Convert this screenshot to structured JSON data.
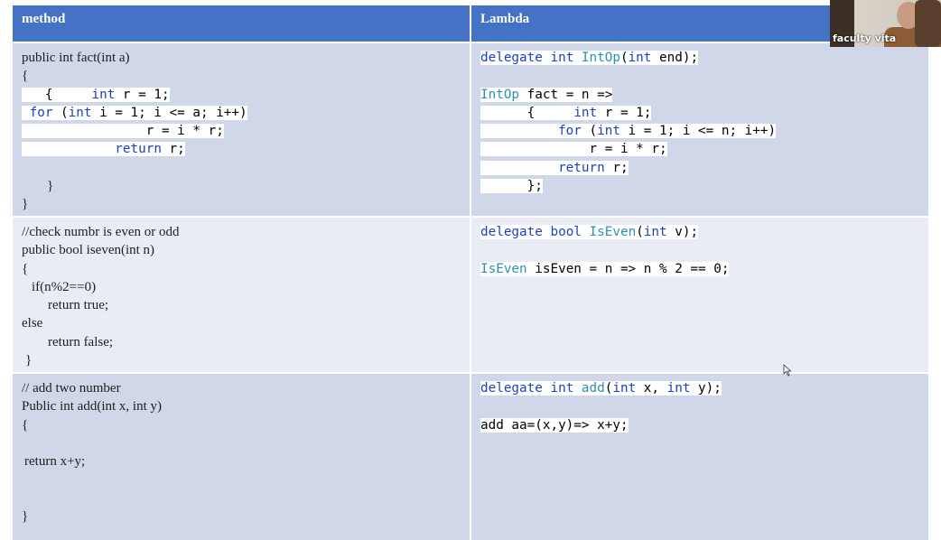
{
  "table": {
    "headers": [
      "method",
      "Lambda"
    ],
    "rows": [
      {
        "method": [
          "public int fact(int a)",
          "{",
          "",
          "",
          "",
          "",
          "",
          "}",
          "}"
        ],
        "lambda": [
          "delegate int IntOp(int end);",
          "",
          "IntOp fact = n =>",
          "{",
          "for",
          "r = i * r;",
          "return r;",
          "};"
        ]
      },
      {
        "method": [
          "//check numbr is even or odd",
          "public bool iseven(int n)",
          "{",
          "if(n%2==0)",
          "return true;",
          "else",
          "return false;",
          "}"
        ],
        "lambda": [
          "delegate bool IsEven(int v);",
          "",
          "IsEven isEven = n => n % 2 == 0;"
        ]
      },
      {
        "method": [
          "// add two number",
          "Public int add(int x, int y)",
          "{",
          "",
          "return x+y;",
          "",
          "",
          "}"
        ],
        "lambda": [
          "delegate int add(int x, int y);",
          "",
          "add aa=(x,y)=> x+y;"
        ]
      }
    ]
  },
  "code": {
    "fact_line3_open": "{",
    "fact_line3_kw": "int",
    "fact_line3_rest": " r = 1;",
    "fact_for_kw": "for",
    "fact_for_paren": " (",
    "fact_for_int": "int",
    "fact_for_rest": " i = 1; i <= a; i++)",
    "fact_assign": "r = i * r;",
    "fact_return_kw": "return",
    "fact_return_rest": " r;",
    "lam1_delegate": "delegate",
    "lam1_int": "int",
    "lam1_type": "IntOp",
    "lam1_paren": "(",
    "lam1_int2": "int",
    "lam1_rest": " end);",
    "lam1_type2": "IntOp",
    "lam1_arrow": " fact = n =>",
    "lam1_brace": "{",
    "lam1_int3": "int",
    "lam1_r1": " r = 1;",
    "lam1_for": "for",
    "lam1_for_paren": " (",
    "lam1_int4": "int",
    "lam1_for_rest": " i = 1; i <= n; i++)",
    "lam1_assign": "r = i * r;",
    "lam1_return": "return",
    "lam1_return_rest": " r;",
    "lam1_close": "};",
    "lam2_delegate": "delegate",
    "lam2_bool": "bool",
    "lam2_type": "IsEven",
    "lam2_paren": "(",
    "lam2_int": "int",
    "lam2_rest": " v);",
    "lam2_type2": "IsEven",
    "lam2_expr": " isEven = n => n % 2 == 0;",
    "lam3_delegate": "delegate",
    "lam3_int": "int",
    "lam3_name": "add",
    "lam3_paren": "(",
    "lam3_int2": "int",
    "lam3_mid": " x, ",
    "lam3_int3": "int",
    "lam3_rest": " y);",
    "lam3_expr": "add aa=(x,y)=> x+y;"
  },
  "webcam": {
    "name": "faculty vita"
  },
  "colors": {
    "header": "#4472c4",
    "row_dark": "#d0d7e9",
    "row_light": "#e9ecf5",
    "keyword": "#1a3fc7",
    "type": "#2b91af"
  },
  "icons": {
    "cursor": "mouse-pointer-icon"
  }
}
